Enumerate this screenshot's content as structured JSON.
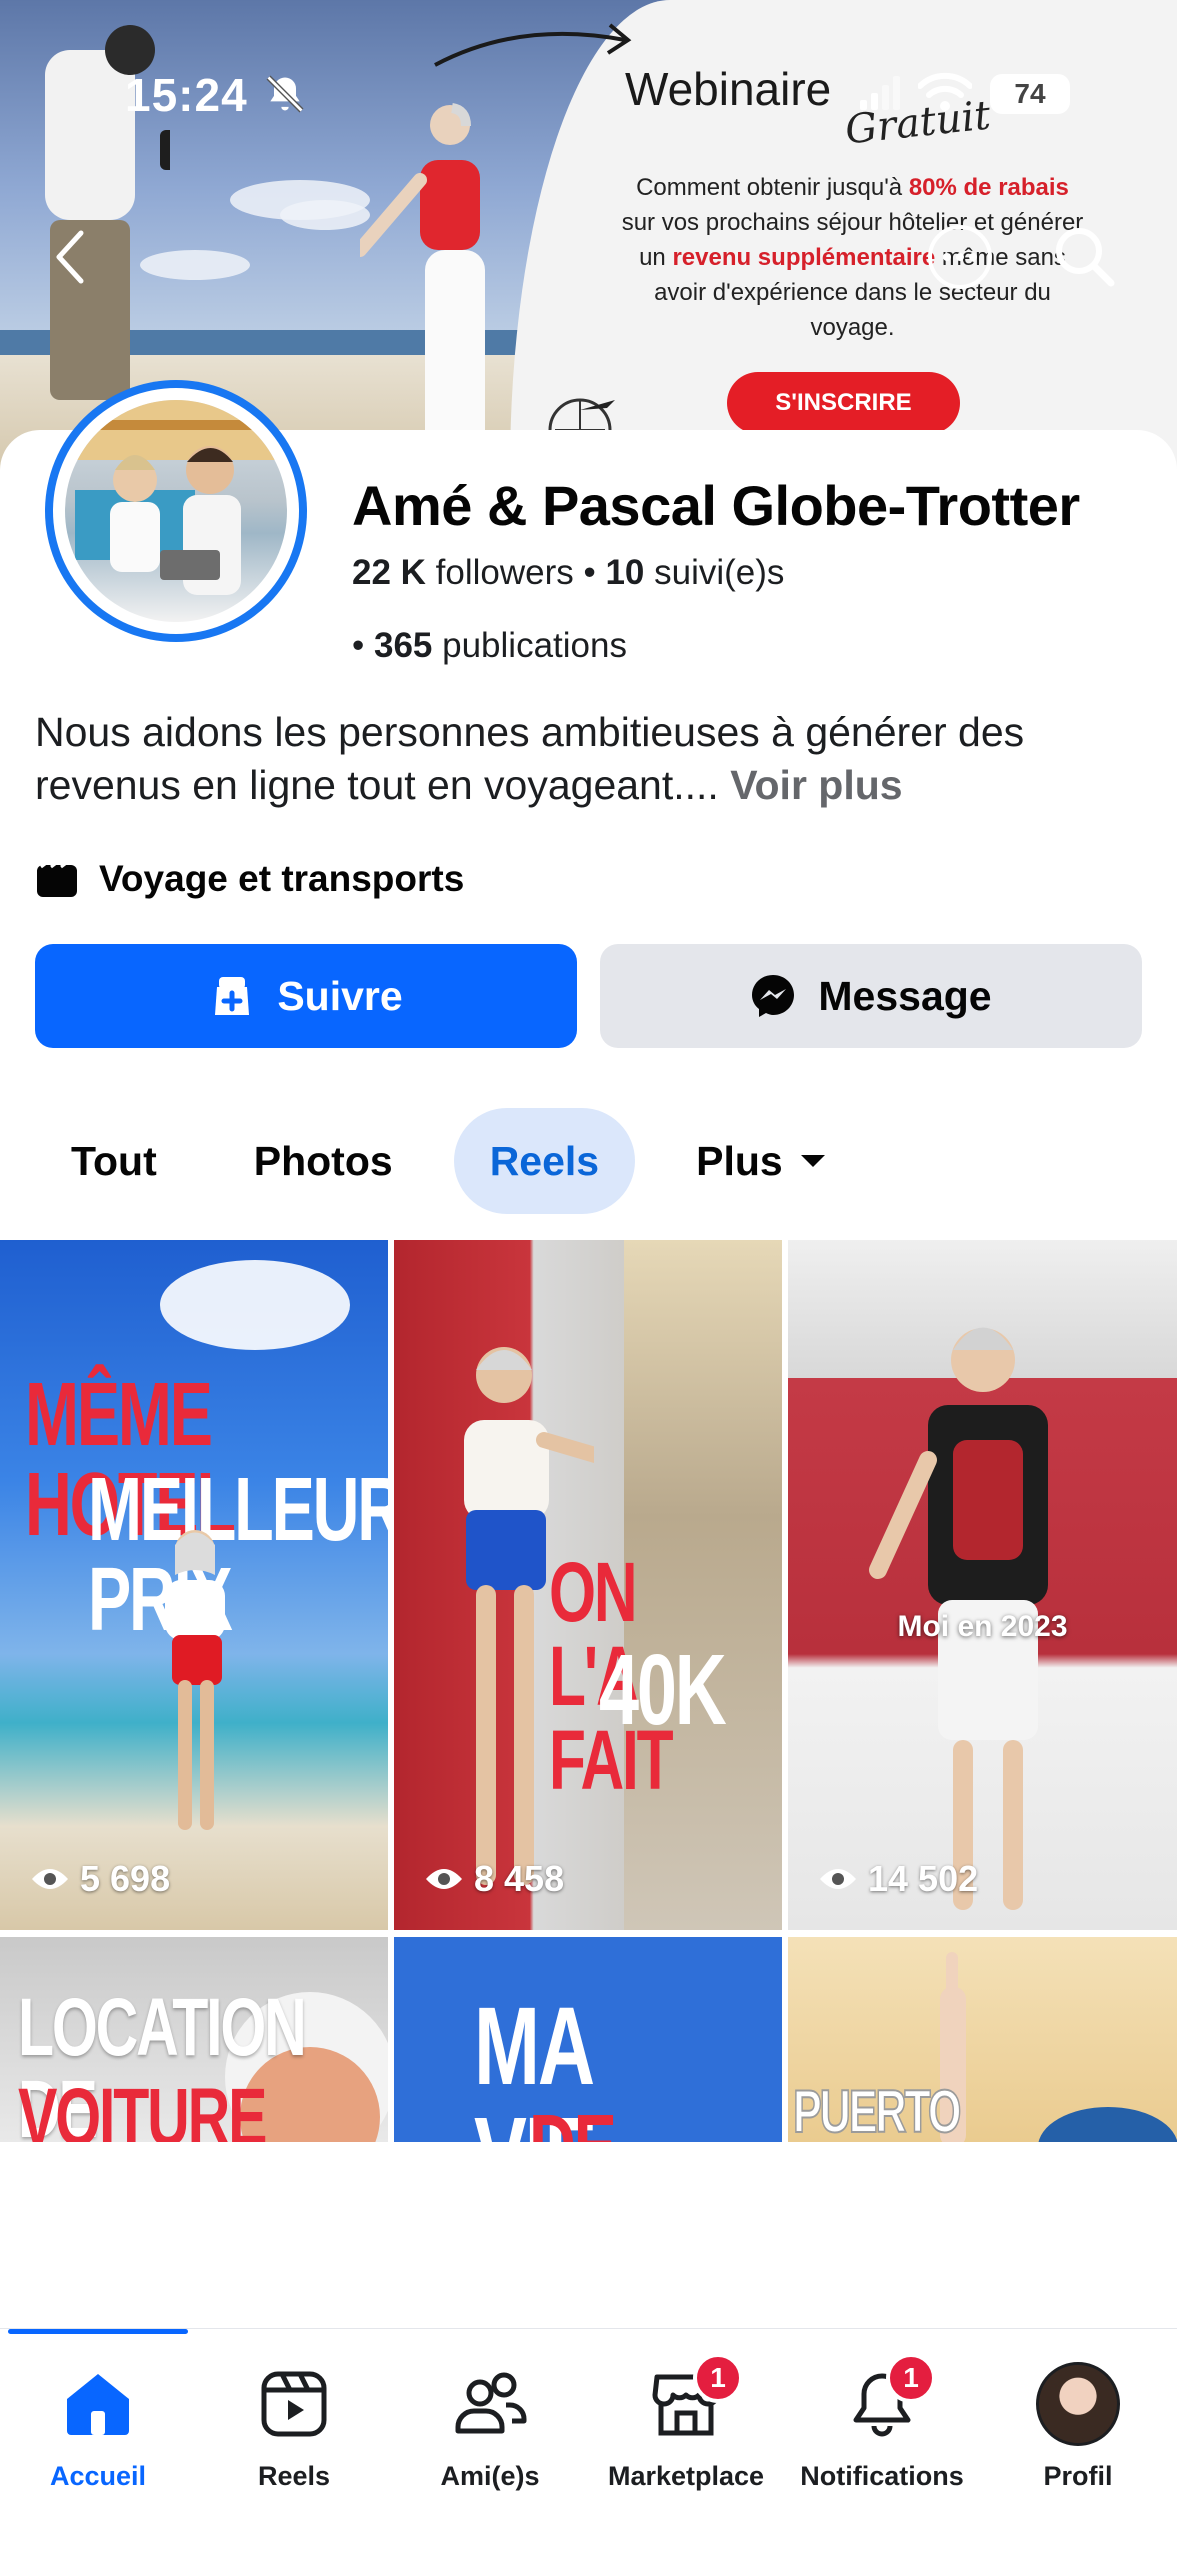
{
  "status_bar": {
    "time": "15:24",
    "battery": "74"
  },
  "cover": {
    "webinar": "Webinaire",
    "gratuit": "Gratuit",
    "promo_line1_a": "Comment obtenir jusqu'à ",
    "promo_line1_b": "80% de rabais",
    "promo_line2": "sur vos prochains séjour hôtelier et générer",
    "promo_line3_a": "un ",
    "promo_line3_b": "revenu supplémentaire",
    "promo_line3_c": " même sans",
    "promo_line4": "avoir d'expérience dans le secteur du",
    "promo_line5": "voyage.",
    "cta": "S'INSCRIRE"
  },
  "profile": {
    "name": "Amé & Pascal Globe-Trotter",
    "followers_count": "22 K",
    "followers_label": " followers",
    "sep": " • ",
    "following_count": "10",
    "following_label": " suivi(e)s",
    "bullet": "• ",
    "posts_count": "365",
    "posts_label": " publications",
    "bio": "Nous aidons les personnes ambitieuses à générer des revenus en ligne tout en voyageant.... ",
    "bio_more": "Voir plus",
    "category": "Voyage et transports"
  },
  "actions": {
    "follow": "Suivre",
    "message": "Message"
  },
  "tabs": [
    {
      "label": "Tout"
    },
    {
      "label": "Photos"
    },
    {
      "label": "Reels"
    },
    {
      "label": "Plus"
    }
  ],
  "reels": [
    {
      "line1": "MÊME HOTEL",
      "line2": "MEILLEUR PRIX",
      "views": "5 698"
    },
    {
      "line1": "ON L'A FAIT",
      "line2": "40K",
      "views": "8 458"
    },
    {
      "caption": "Moi en 2023",
      "views": "14 502"
    },
    {
      "line1": "LOCATION DE",
      "line2": "VOITURE"
    },
    {
      "line1": "MA VIE",
      "line2": "DE RÊVE"
    },
    {
      "line1": "PUERTO"
    }
  ],
  "bottom_nav": [
    {
      "label": "Accueil"
    },
    {
      "label": "Reels"
    },
    {
      "label": "Ami(e)s"
    },
    {
      "label": "Marketplace",
      "badge": "1"
    },
    {
      "label": "Notifications",
      "badge": "1"
    },
    {
      "label": "Profil"
    }
  ],
  "colors": {
    "brand_blue": "#0866ff",
    "cta_red": "#e41e26",
    "badge_red": "#e41e3f"
  }
}
